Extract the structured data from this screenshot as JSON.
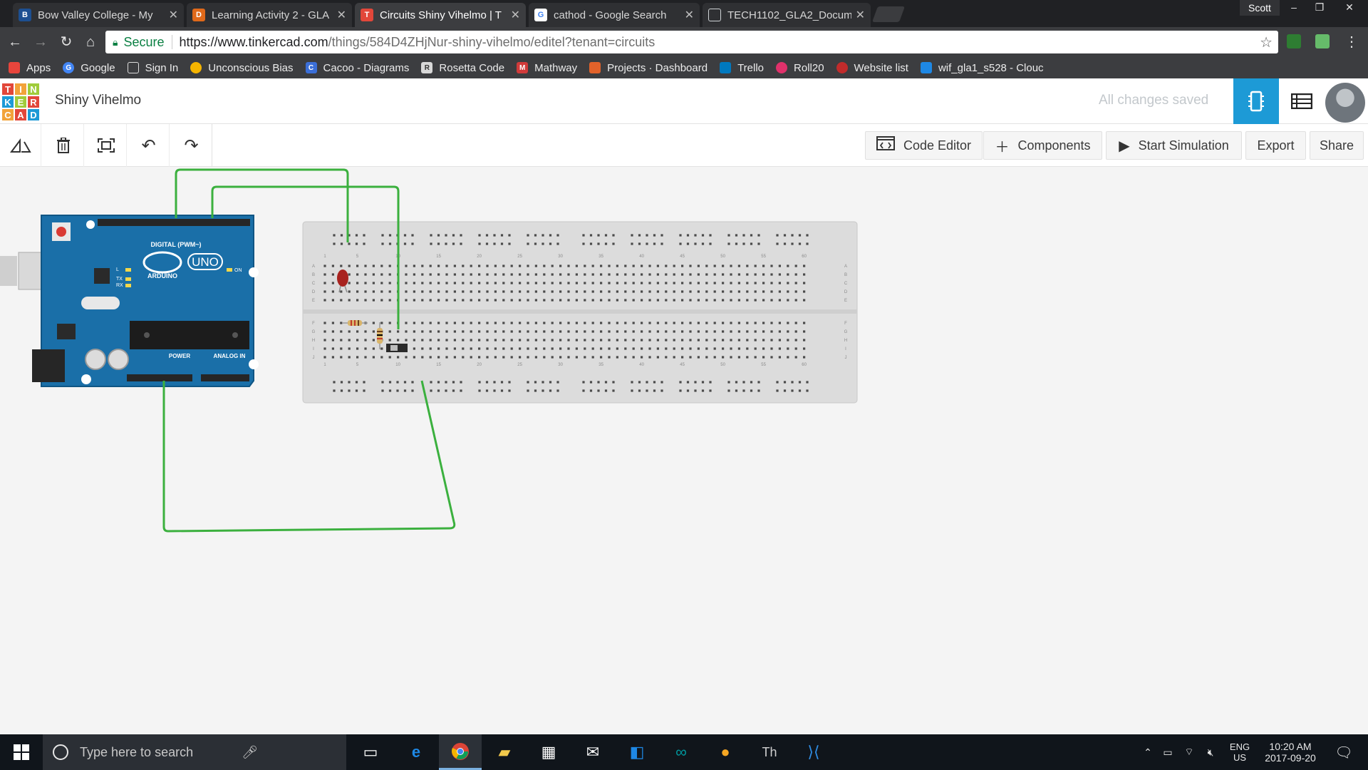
{
  "browser": {
    "tabs": [
      {
        "title": "Bow Valley College - My",
        "icon": "B",
        "icon_color": "#1d4f91",
        "active": false
      },
      {
        "title": "Learning Activity 2 - GLA",
        "icon": "D",
        "icon_color": "#e0691a",
        "active": false
      },
      {
        "title": "Circuits Shiny Vihelmo | T",
        "icon": "T",
        "icon_color": "#e2473a",
        "active": true
      },
      {
        "title": "cathod - Google Search",
        "icon": "G",
        "icon_color": "#ffffff",
        "active": false
      },
      {
        "title": "TECH1102_GLA2_Docum",
        "icon": "D",
        "icon_color": "#cfd3d6",
        "active": false
      }
    ],
    "profile_name": "Scott",
    "window_controls": {
      "minimize": "–",
      "restore": "❐",
      "close": "✕"
    },
    "secure_label": "Secure",
    "url_host": "https://www.tinkercad.com",
    "url_path": "/things/584D4ZHjNur-shiny-vihelmo/editel?tenant=circuits",
    "bookmarks": [
      {
        "label": "Apps",
        "icon_color": "#e8453c"
      },
      {
        "label": "Google",
        "icon_color": "#4285f4"
      },
      {
        "label": "Sign In",
        "icon_color": "#3c3d40"
      },
      {
        "label": "Unconscious Bias",
        "icon_color": "#f5b400"
      },
      {
        "label": "Cacoo - Diagrams",
        "icon_color": "#3b6fd8"
      },
      {
        "label": "Rosetta Code",
        "icon_color": "#d8d8d8"
      },
      {
        "label": "Mathway",
        "icon_color": "#d13a3a"
      },
      {
        "label": "Projects · Dashboard",
        "icon_color": "#e2622a"
      },
      {
        "label": "Trello",
        "icon_color": "#0079bf"
      },
      {
        "label": "Roll20",
        "icon_color": "#e0316b"
      },
      {
        "label": "Website list",
        "icon_color": "#c12b2b"
      },
      {
        "label": "wif_gla1_s528 - Clouc",
        "icon_color": "#1e88e5"
      }
    ]
  },
  "app": {
    "logo_letters": [
      "T",
      "I",
      "N",
      "K",
      "E",
      "R",
      "C",
      "A",
      "D"
    ],
    "logo_colors": [
      "#e2473a",
      "#f2a33a",
      "#a0cc3a",
      "#1d9ad6",
      "#a0cc3a",
      "#e2473a",
      "#f2a33a",
      "#e2473a",
      "#1d9ad6"
    ],
    "design_title": "Shiny Vihelmo",
    "save_status": "All changes saved",
    "accent": "#1d9ad6",
    "toolbar": {
      "code_editor": "Code Editor",
      "components": "Components",
      "start_simulation": "Start Simulation",
      "export": "Export",
      "share": "Share"
    }
  },
  "canvas": {
    "arduino": {
      "brand": "ARDUINO",
      "model": "UNO",
      "digital_label": "DIGITAL (PWM~)",
      "power_label": "POWER",
      "analog_label": "ANALOG IN",
      "tx_label": "TX",
      "rx_label": "RX",
      "l_label": "L",
      "on_label": "ON"
    },
    "breadboard": {
      "column_numbers": [
        "1",
        "5",
        "10",
        "15",
        "20",
        "25",
        "30",
        "35",
        "40",
        "45",
        "50",
        "55",
        "60"
      ],
      "row_letters": [
        "A",
        "B",
        "C",
        "D",
        "E",
        "F",
        "G",
        "H",
        "I",
        "J"
      ]
    },
    "wire_color": "#3bb03e"
  },
  "taskbar": {
    "search_placeholder": "Type here to search",
    "language": "ENG",
    "region": "US",
    "time": "10:20 AM",
    "date": "2017-09-20"
  }
}
